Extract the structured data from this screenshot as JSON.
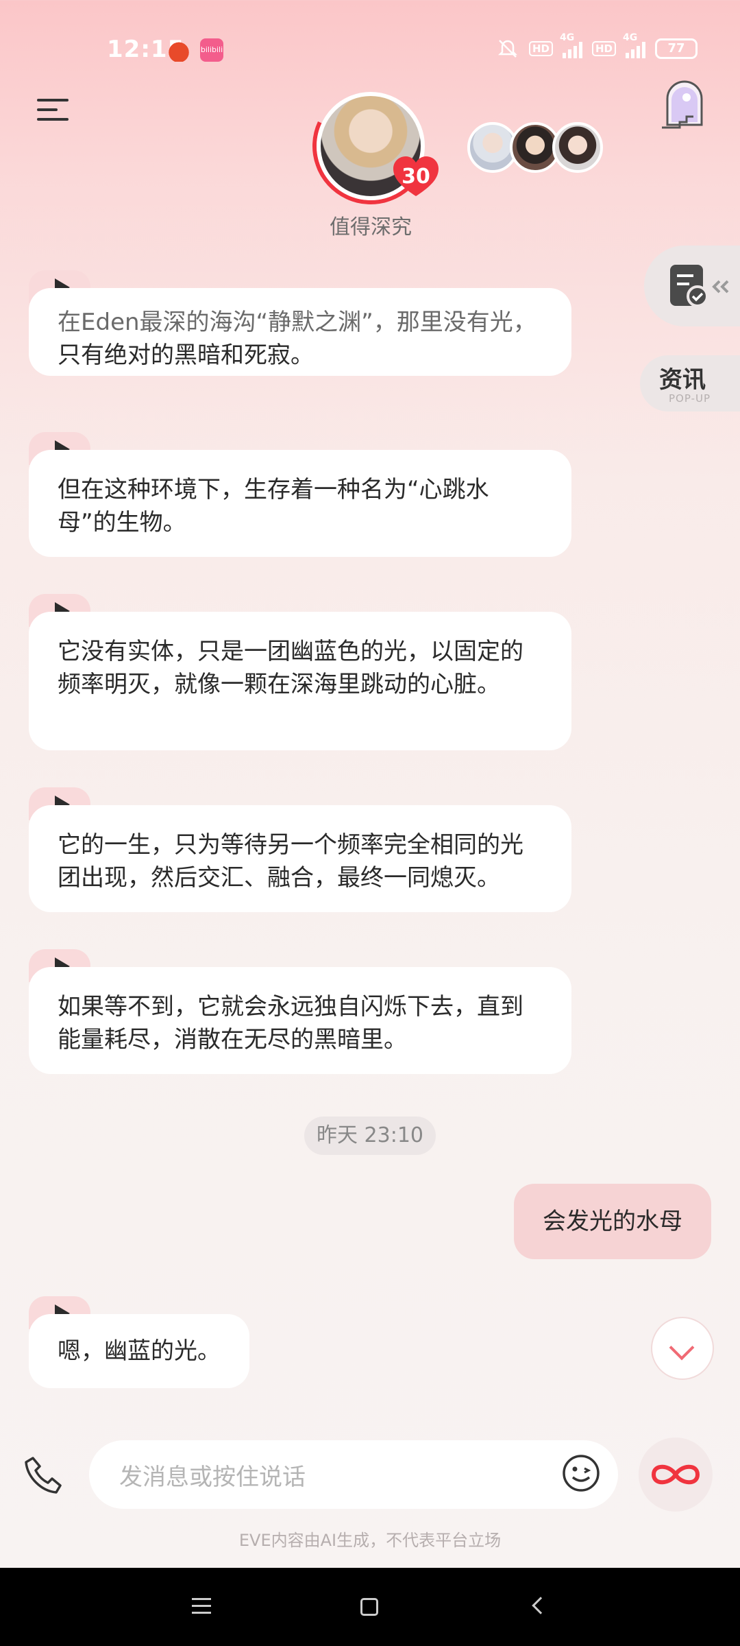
{
  "status_bar": {
    "time": "12:15",
    "network_1": "4G",
    "network_2": "4G",
    "hd_1": "HD",
    "hd_2": "HD",
    "battery": "77",
    "app_badge_2": "bilibili"
  },
  "header": {
    "character_level": "30",
    "character_title": "值得深究"
  },
  "side": {
    "news_label": "资讯",
    "news_sub": "POP-UP"
  },
  "messages": [
    {
      "text_dim": "在Eden最深的海沟“静默之渊”，那里没有光，",
      "text": "只有绝对的黑暗和死寂。"
    },
    {
      "text": "但在这种环境下，生存着一种名为“心跳水母”的生物。"
    },
    {
      "text": "它没有实体，只是一团幽蓝色的光，以固定的频率明灭，就像一颗在深海里跳动的心脏。"
    },
    {
      "text": "它的一生，只为等待另一个频率完全相同的光团出现，然后交汇、融合，最终一同熄灭。"
    },
    {
      "text": "如果等不到，它就会永远独自闪烁下去，直到能量耗尽，消散在无尽的黑暗里。"
    }
  ],
  "timestamp": "昨天 23:10",
  "user_message": "会发光的水母",
  "last_reply": "嗯，幽蓝的光。",
  "input": {
    "placeholder": "发消息或按住说话"
  },
  "disclaimer": "EVE内容由AI生成，不代表平台立场",
  "colors": {
    "accent": "#f0343f",
    "bubble_user": "#f6d3d4",
    "bubble_ai": "#ffffff"
  }
}
